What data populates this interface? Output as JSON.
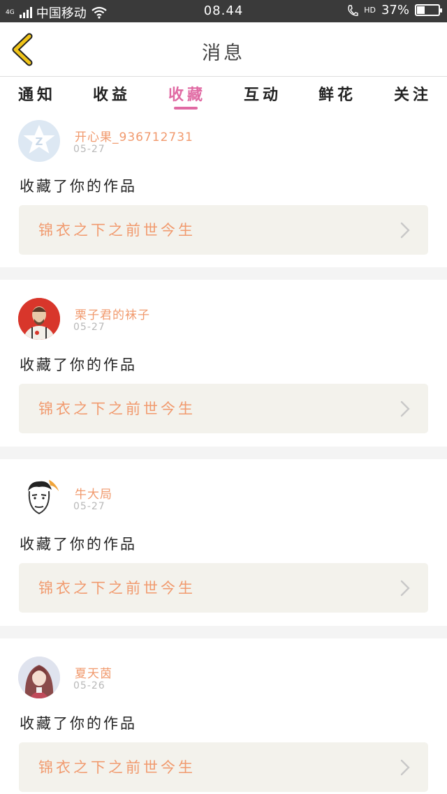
{
  "status_bar": {
    "network_tag": "4G",
    "carrier": "中国移动",
    "time": "08.44",
    "hd": "HD",
    "battery_text": "37%",
    "battery_level": 0.37,
    "icons": [
      "signal-icon",
      "wifi-icon",
      "call-icon",
      "battery-icon"
    ]
  },
  "header": {
    "title": "消息",
    "back_icon": "back-chevron-icon",
    "accent_color": "#f0c419"
  },
  "tabs": {
    "items": [
      "通知",
      "收益",
      "收藏",
      "互动",
      "鲜花",
      "关注"
    ],
    "active": "收藏",
    "active_color": "#e06aa3"
  },
  "messages": [
    {
      "user": "开心果_936712731",
      "date": "05-27",
      "action": "收藏了你的作品",
      "work": "锦衣之下之前世今生",
      "avatar": "default-avatar-icon"
    },
    {
      "user": "栗子君的袜子",
      "date": "05-27",
      "action": "收藏了你的作品",
      "work": "锦衣之下之前世今生",
      "avatar": "user-avatar"
    },
    {
      "user": "牛大局",
      "date": "05-27",
      "action": "收藏了你的作品",
      "work": "锦衣之下之前世今生",
      "avatar": "user-avatar"
    },
    {
      "user": "夏天茵",
      "date": "05-26",
      "action": "收藏了你的作品",
      "work": "锦衣之下之前世今生",
      "avatar": "user-avatar"
    }
  ],
  "colors": {
    "username": "#f19a6e",
    "work_card_bg": "#f3f2ec",
    "separator": "#f4f4f4"
  }
}
